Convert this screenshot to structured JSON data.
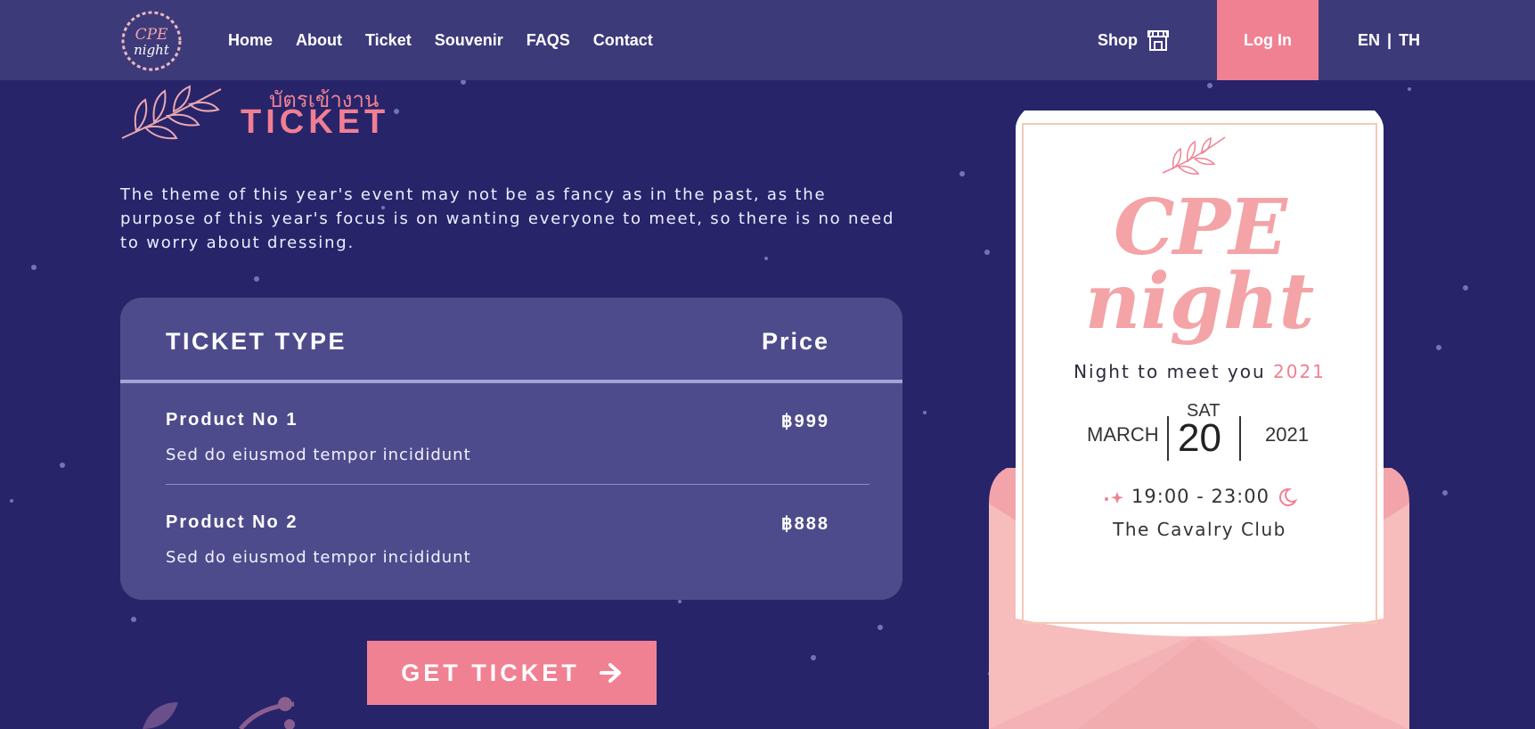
{
  "nav": {
    "logo_alt": "CPE night",
    "links": [
      "Home",
      "About",
      "Ticket",
      "Souvenir",
      "FAQS",
      "Contact"
    ],
    "shop_label": "Shop",
    "login_label": "Log In",
    "lang_en": "EN",
    "lang_sep": "|",
    "lang_th": "TH"
  },
  "header": {
    "thai_title": "บัตรเข้างาน",
    "title": "TICKET"
  },
  "description": "The theme of this year's event may not be as fancy as in the past, as the purpose of this year's focus is on wanting everyone to meet, so there is no need to worry about dressing.",
  "table": {
    "col_type": "TICKET TYPE",
    "col_price": "Price",
    "rows": [
      {
        "name": "Product No 1",
        "price": "฿999",
        "desc": "Sed do eiusmod tempor incididunt"
      },
      {
        "name": "Product No 2",
        "price": "฿888",
        "desc": "Sed do eiusmod tempor incididunt"
      }
    ]
  },
  "cta": {
    "label": "GET TICKET"
  },
  "ticket_art": {
    "brand_line1": "CPE",
    "brand_line2": "night",
    "tagline": "Night to meet you",
    "tagline_year": "2021",
    "month": "MARCH",
    "dow": "SAT",
    "day": "20",
    "year": "2021",
    "time": "19:00 - 23:00",
    "venue": "The Cavalry Club"
  },
  "colors": {
    "background": "#27246a",
    "nav": "#3d3a7a",
    "accent": "#f08193",
    "table": "#4e4b8c"
  }
}
